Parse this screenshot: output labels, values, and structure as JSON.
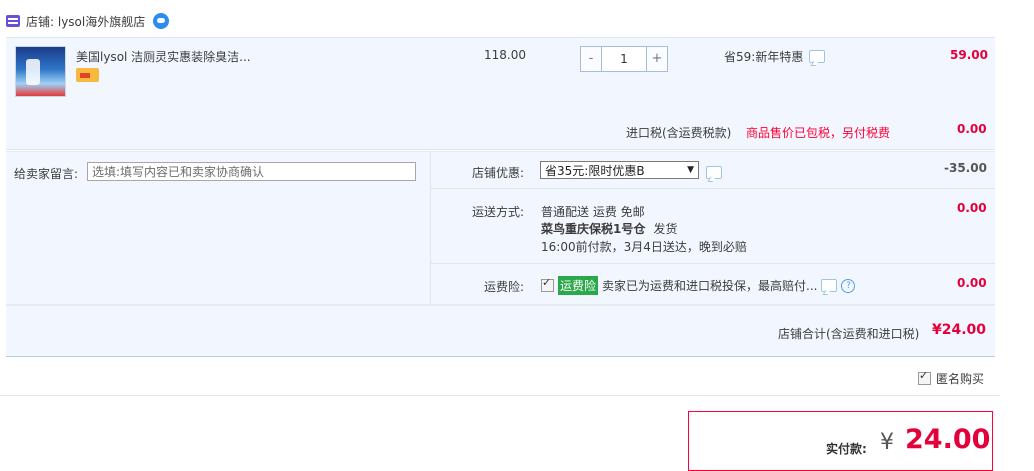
{
  "shop": {
    "label": "店铺: lysol海外旗舰店"
  },
  "item": {
    "title": "美国lysol 洁厕灵实惠装除臭洁...",
    "price": "118.00",
    "quantity": "1",
    "qty_minus": "-",
    "qty_plus": "+",
    "promo": "省59:新年特惠",
    "subtotal": "59.00"
  },
  "tax": {
    "label": "进口税(含运费税款)",
    "note": "商品售价已包税，另付税费",
    "amount": "0.00"
  },
  "note": {
    "label": "给卖家留言:",
    "placeholder": "选填:填写内容已和卖家协商确认"
  },
  "discount": {
    "label": "店铺优惠:",
    "selected": "省35元:限时优惠B",
    "amount": "-35.00"
  },
  "shipping": {
    "label": "运送方式:",
    "method": "普通配送 运费 免邮",
    "warehouse": "菜鸟重庆保税1号仓",
    "dispatch": "发货",
    "promise": "16:00前付款，3月4日送达，晚到必赔",
    "amount": "0.00"
  },
  "insurance": {
    "label": "运费险:",
    "badge": "运费险",
    "text": "卖家已为运费和进口税投保，最高赔付...",
    "amount": "0.00"
  },
  "total": {
    "label": "店铺合计(含运费和进口税)",
    "amount": "¥24.00"
  },
  "anonymous": {
    "label": "匿名购买"
  },
  "pay": {
    "label": "实付款:",
    "currency": "¥",
    "amount": "24.00"
  },
  "colors": {
    "accent": "#ff0036",
    "panel": "#f2f7ff",
    "badge": "#2ba84a"
  }
}
